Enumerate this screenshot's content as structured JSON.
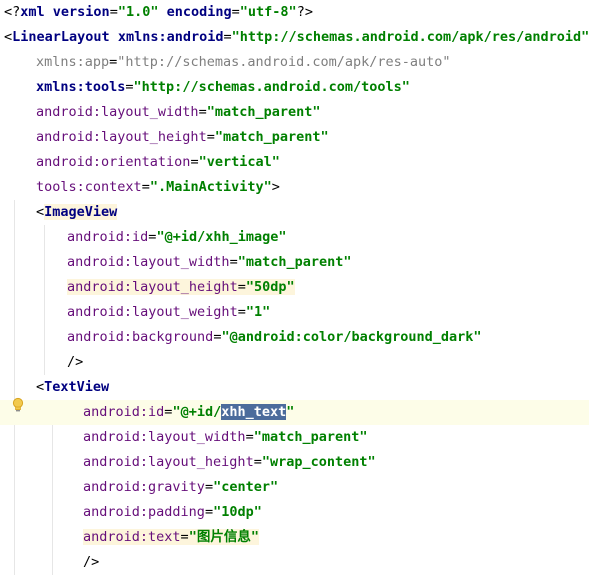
{
  "editor": {
    "lines": [
      {
        "indent": 0,
        "tokens": [
          {
            "t": "<?",
            "c": "punct"
          },
          {
            "t": "xml ",
            "c": "kw"
          },
          {
            "t": "version",
            "c": "kw"
          },
          {
            "t": "=",
            "c": "punct"
          },
          {
            "t": "\"1.0\"",
            "c": "str"
          },
          {
            "t": " ",
            "c": "punct"
          },
          {
            "t": "encoding",
            "c": "kw"
          },
          {
            "t": "=",
            "c": "punct"
          },
          {
            "t": "\"utf-8\"",
            "c": "str"
          },
          {
            "t": "?>",
            "c": "punct"
          }
        ]
      },
      {
        "indent": 0,
        "tokens": [
          {
            "t": "<",
            "c": "punct"
          },
          {
            "t": "LinearLayout",
            "c": "tag"
          },
          {
            "t": " ",
            "c": "punct"
          },
          {
            "t": "xmlns:android",
            "c": "kw"
          },
          {
            "t": "=",
            "c": "punct"
          },
          {
            "t": "\"http://schemas.android.com/apk/res/android\"",
            "c": "str"
          }
        ]
      },
      {
        "indent": 1,
        "tokens": [
          {
            "t": "xmlns:app",
            "c": "attr-faded"
          },
          {
            "t": "=",
            "c": "punct"
          },
          {
            "t": "\"http://schemas.android.com/apk/res-auto\"",
            "c": "str-faded"
          }
        ]
      },
      {
        "indent": 1,
        "tokens": [
          {
            "t": "xmlns:tools",
            "c": "kw"
          },
          {
            "t": "=",
            "c": "punct"
          },
          {
            "t": "\"http://schemas.android.com/tools\"",
            "c": "str"
          }
        ]
      },
      {
        "indent": 1,
        "tokens": [
          {
            "t": "android:",
            "c": "ns"
          },
          {
            "t": "layout_width",
            "c": "attr"
          },
          {
            "t": "=",
            "c": "punct"
          },
          {
            "t": "\"match_parent\"",
            "c": "str"
          }
        ]
      },
      {
        "indent": 1,
        "tokens": [
          {
            "t": "android:",
            "c": "ns"
          },
          {
            "t": "layout_height",
            "c": "attr"
          },
          {
            "t": "=",
            "c": "punct"
          },
          {
            "t": "\"match_parent\"",
            "c": "str"
          }
        ]
      },
      {
        "indent": 1,
        "tokens": [
          {
            "t": "android:",
            "c": "ns"
          },
          {
            "t": "orientation",
            "c": "attr"
          },
          {
            "t": "=",
            "c": "punct"
          },
          {
            "t": "\"vertical\"",
            "c": "str"
          }
        ]
      },
      {
        "indent": 1,
        "tokens": [
          {
            "t": "tools:",
            "c": "ns"
          },
          {
            "t": "context",
            "c": "attr"
          },
          {
            "t": "=",
            "c": "punct"
          },
          {
            "t": "\".MainActivity\"",
            "c": "str"
          },
          {
            "t": ">",
            "c": "punct"
          }
        ]
      },
      {
        "indent": 1,
        "tokens": [
          {
            "t": "<",
            "c": "punct"
          },
          {
            "t": "ImageView",
            "c": "tag",
            "bg": "yellow"
          }
        ]
      },
      {
        "indent": 2,
        "tokens": [
          {
            "t": "android:",
            "c": "ns"
          },
          {
            "t": "id",
            "c": "attr"
          },
          {
            "t": "=",
            "c": "punct"
          },
          {
            "t": "\"@+id/xhh_image\"",
            "c": "str"
          }
        ]
      },
      {
        "indent": 2,
        "tokens": [
          {
            "t": "android:",
            "c": "ns"
          },
          {
            "t": "layout_width",
            "c": "attr"
          },
          {
            "t": "=",
            "c": "punct"
          },
          {
            "t": "\"match_parent\"",
            "c": "str"
          }
        ]
      },
      {
        "indent": 2,
        "tokens": [
          {
            "t": "android:",
            "c": "ns",
            "bg": "yellow"
          },
          {
            "t": "layout_height",
            "c": "attr",
            "bg": "yellow"
          },
          {
            "t": "=",
            "c": "punct",
            "bg": "yellow"
          },
          {
            "t": "\"50dp\"",
            "c": "str",
            "bg": "yellow"
          }
        ]
      },
      {
        "indent": 2,
        "tokens": [
          {
            "t": "android:",
            "c": "ns"
          },
          {
            "t": "layout_weight",
            "c": "attr"
          },
          {
            "t": "=",
            "c": "punct"
          },
          {
            "t": "\"1\"",
            "c": "str"
          }
        ]
      },
      {
        "indent": 2,
        "tokens": [
          {
            "t": "android:",
            "c": "ns"
          },
          {
            "t": "background",
            "c": "attr"
          },
          {
            "t": "=",
            "c": "punct"
          },
          {
            "t": "\"@android:color/background_dark\"",
            "c": "str"
          }
        ]
      },
      {
        "indent": 2,
        "tokens": [
          {
            "t": "/>",
            "c": "punct"
          }
        ]
      },
      {
        "indent": 1,
        "tokens": [
          {
            "t": "<",
            "c": "punct"
          },
          {
            "t": "TextView",
            "c": "tag"
          }
        ]
      },
      {
        "indent": 3,
        "highlight": true,
        "tokens": [
          {
            "t": "android:",
            "c": "ns"
          },
          {
            "t": "id",
            "c": "attr"
          },
          {
            "t": "=",
            "c": "punct"
          },
          {
            "t": "\"@+id/",
            "c": "str"
          },
          {
            "t": "xhh_text",
            "c": "str",
            "bg": "select"
          },
          {
            "t": "\"",
            "c": "str"
          }
        ]
      },
      {
        "indent": 3,
        "tokens": [
          {
            "t": "android:",
            "c": "ns"
          },
          {
            "t": "layout_width",
            "c": "attr"
          },
          {
            "t": "=",
            "c": "punct"
          },
          {
            "t": "\"match_parent\"",
            "c": "str"
          }
        ]
      },
      {
        "indent": 3,
        "tokens": [
          {
            "t": "android:",
            "c": "ns"
          },
          {
            "t": "layout_height",
            "c": "attr"
          },
          {
            "t": "=",
            "c": "punct"
          },
          {
            "t": "\"wrap_content\"",
            "c": "str"
          }
        ]
      },
      {
        "indent": 3,
        "tokens": [
          {
            "t": "android:",
            "c": "ns"
          },
          {
            "t": "gravity",
            "c": "attr"
          },
          {
            "t": "=",
            "c": "punct"
          },
          {
            "t": "\"center\"",
            "c": "str"
          }
        ]
      },
      {
        "indent": 3,
        "tokens": [
          {
            "t": "android:",
            "c": "ns"
          },
          {
            "t": "padding",
            "c": "attr"
          },
          {
            "t": "=",
            "c": "punct"
          },
          {
            "t": "\"10dp\"",
            "c": "str"
          }
        ]
      },
      {
        "indent": 3,
        "tokens": [
          {
            "t": "android:",
            "c": "ns",
            "bg": "yellow"
          },
          {
            "t": "text",
            "c": "attr",
            "bg": "yellow"
          },
          {
            "t": "=",
            "c": "punct",
            "bg": "yellow"
          },
          {
            "t": "\"图片信息\"",
            "c": "str",
            "bg": "yellow"
          }
        ]
      },
      {
        "indent": 3,
        "tokens": [
          {
            "t": "/>",
            "c": "punct"
          }
        ]
      }
    ]
  },
  "colors": {
    "tag": "#000080",
    "attr": "#660e7a",
    "string": "#008000",
    "faded": "#7f7f7f",
    "selection": "#4c6c9c",
    "tag_highlight": "#fdf5dc",
    "line_highlight": "#fdfde8"
  },
  "icons": {
    "intention_bulb": "lightbulb-icon"
  }
}
